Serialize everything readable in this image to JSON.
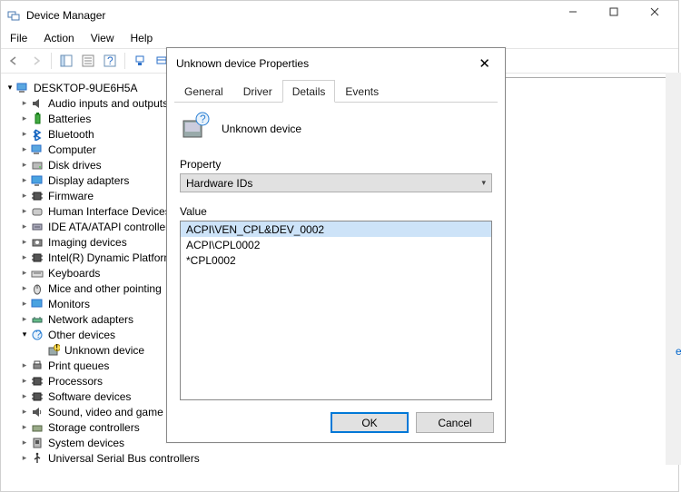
{
  "window": {
    "title": "Device Manager"
  },
  "menubar": {
    "file": "File",
    "action": "Action",
    "view": "View",
    "help": "Help"
  },
  "tree": {
    "root": "DESKTOP-9UE6H5A",
    "items": [
      "Audio inputs and outputs",
      "Batteries",
      "Bluetooth",
      "Computer",
      "Disk drives",
      "Display adapters",
      "Firmware",
      "Human Interface Devices",
      "IDE ATA/ATAPI controllers",
      "Imaging devices",
      "Intel(R) Dynamic Platform",
      "Keyboards",
      "Mice and other pointing",
      "Monitors",
      "Network adapters",
      "Other devices",
      "Print queues",
      "Processors",
      "Software devices",
      "Sound, video and game",
      "Storage controllers",
      "System devices",
      "Universal Serial Bus controllers"
    ],
    "unknown_device": "Unknown device"
  },
  "dialog": {
    "title": "Unknown device Properties",
    "tabs": {
      "general": "General",
      "driver": "Driver",
      "details": "Details",
      "events": "Events"
    },
    "device_name": "Unknown device",
    "property_label": "Property",
    "property_value": "Hardware IDs",
    "value_label": "Value",
    "values": [
      "ACPI\\VEN_CPL&DEV_0002",
      "ACPI\\CPL0002",
      "*CPL0002"
    ],
    "ok": "OK",
    "cancel": "Cancel"
  },
  "edge_text": "et"
}
